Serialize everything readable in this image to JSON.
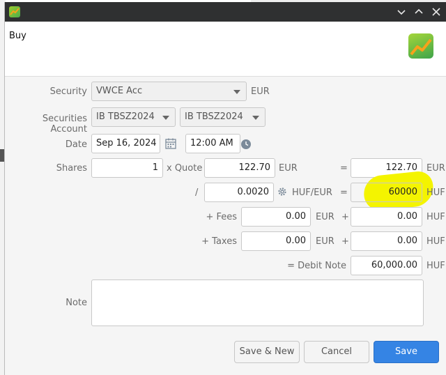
{
  "dialog": {
    "title": "Buy",
    "window_controls": [
      "chevron-down",
      "chevron-up",
      "close"
    ]
  },
  "form": {
    "security": {
      "label": "Security",
      "value": "VWCE Acc",
      "currency": "EUR"
    },
    "securities_account": {
      "label": "Securities Account",
      "value_1": "IB TBSZ2024",
      "value_2": "IB TBSZ2024"
    },
    "date": {
      "label": "Date",
      "value": "Sep 16, 2024",
      "time": "12:00 AM"
    },
    "shares": {
      "label": "Shares",
      "value": "1",
      "x_quote_label": "x Quote",
      "quote": "122.70",
      "quote_currency": "EUR",
      "equals": "=",
      "total": "122.70",
      "total_currency": "EUR"
    },
    "exchange": {
      "divider": "/",
      "rate": "0.0020",
      "pair": "HUF/EUR",
      "equals": "=",
      "converted": "60000",
      "converted_currency": "HUF"
    },
    "fees": {
      "label": "+ Fees",
      "value": "0.00",
      "currency": "EUR",
      "plus": "+",
      "converted": "0.00",
      "converted_currency": "HUF"
    },
    "taxes": {
      "label": "+ Taxes",
      "value": "0.00",
      "currency": "EUR",
      "plus": "+",
      "converted": "0.00",
      "converted_currency": "HUF"
    },
    "debit_note": {
      "label": "= Debit Note",
      "value": "60,000.00",
      "currency": "HUF"
    },
    "note": {
      "label": "Note",
      "value": ""
    }
  },
  "buttons": {
    "save_new": "Save & New",
    "cancel": "Cancel",
    "save": "Save"
  },
  "colors": {
    "titlebar": "#2f3031",
    "primary": "#3584e4",
    "highlight": "#f4f400"
  }
}
